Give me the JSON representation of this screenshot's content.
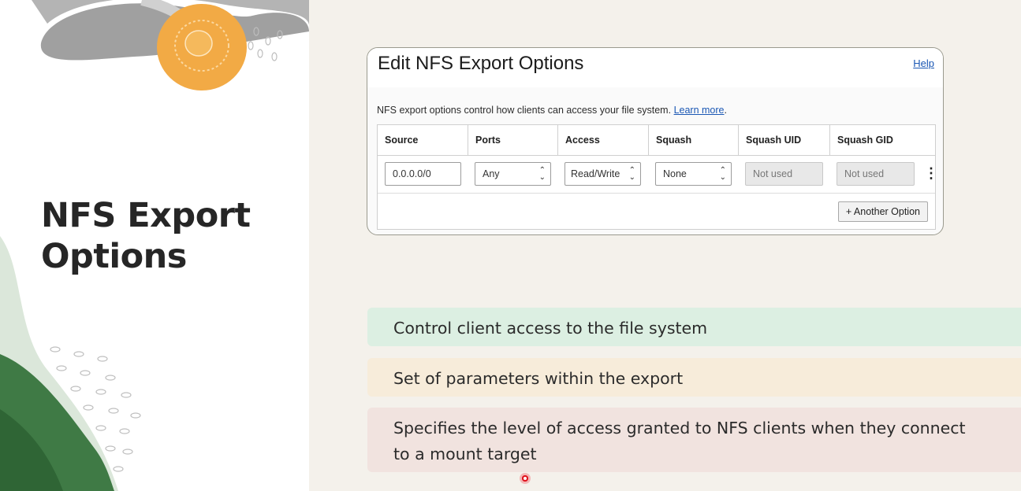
{
  "slide": {
    "title_line1": "NFS Export",
    "title_line2": "Options"
  },
  "dialog": {
    "title": "Edit NFS Export Options",
    "help_link": "Help",
    "description": "NFS export options control how clients can access your file system.",
    "learn_more": "Learn more",
    "description_end": ".",
    "columns": [
      "Source",
      "Ports",
      "Access",
      "Squash",
      "Squash UID",
      "Squash GID"
    ],
    "row": {
      "source": "0.0.0.0/0",
      "ports": "Any",
      "access": "Read/Write",
      "squash": "None",
      "squash_uid": "Not used",
      "squash_gid": "Not used"
    },
    "add_option_button": "+ Another Option"
  },
  "bullets": [
    {
      "text": "Control client access to the file system",
      "color": "#dcefe2"
    },
    {
      "text": "Set of parameters within the export",
      "color": "#f7ecda"
    },
    {
      "text_line1": "Specifies the level of access granted to NFS clients when they connect",
      "text_line2": "to a mount target",
      "color": "#f1e3df"
    }
  ],
  "colors": {
    "link": "#1a57b4",
    "title_text": "#262626",
    "deco_orange": "#f2aa45",
    "deco_green": "#3f7a45",
    "deco_gray": "#9b9b9b"
  },
  "icons": [
    "up-down-chevron-icon",
    "kebab-menu-icon"
  ]
}
